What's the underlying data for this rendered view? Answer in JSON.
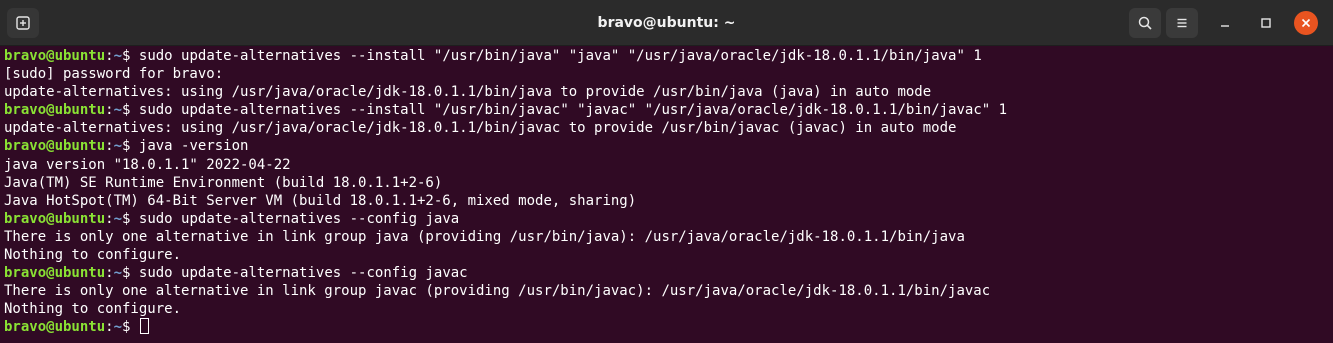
{
  "window": {
    "title": "bravo@ubuntu: ~"
  },
  "terminal": {
    "prompt": {
      "user_host": "bravo@ubuntu",
      "colon": ":",
      "path": "~",
      "symbol": "$ "
    },
    "lines": [
      {
        "type": "command",
        "text": "sudo update-alternatives --install \"/usr/bin/java\" \"java\" \"/usr/java/oracle/jdk-18.0.1.1/bin/java\" 1"
      },
      {
        "type": "output",
        "text": "[sudo] password for bravo:"
      },
      {
        "type": "output",
        "text": "update-alternatives: using /usr/java/oracle/jdk-18.0.1.1/bin/java to provide /usr/bin/java (java) in auto mode"
      },
      {
        "type": "command",
        "text": "sudo update-alternatives --install \"/usr/bin/javac\" \"javac\" \"/usr/java/oracle/jdk-18.0.1.1/bin/javac\" 1"
      },
      {
        "type": "output",
        "text": "update-alternatives: using /usr/java/oracle/jdk-18.0.1.1/bin/javac to provide /usr/bin/javac (javac) in auto mode"
      },
      {
        "type": "command",
        "text": "java -version"
      },
      {
        "type": "output",
        "text": "java version \"18.0.1.1\" 2022-04-22"
      },
      {
        "type": "output",
        "text": "Java(TM) SE Runtime Environment (build 18.0.1.1+2-6)"
      },
      {
        "type": "output",
        "text": "Java HotSpot(TM) 64-Bit Server VM (build 18.0.1.1+2-6, mixed mode, sharing)"
      },
      {
        "type": "command",
        "text": "sudo update-alternatives --config java"
      },
      {
        "type": "output",
        "text": "There is only one alternative in link group java (providing /usr/bin/java): /usr/java/oracle/jdk-18.0.1.1/bin/java"
      },
      {
        "type": "output",
        "text": "Nothing to configure."
      },
      {
        "type": "command",
        "text": "sudo update-alternatives --config javac"
      },
      {
        "type": "output",
        "text": "There is only one alternative in link group javac (providing /usr/bin/javac): /usr/java/oracle/jdk-18.0.1.1/bin/javac"
      },
      {
        "type": "output",
        "text": "Nothing to configure."
      },
      {
        "type": "current",
        "text": ""
      }
    ]
  },
  "colors": {
    "background": "#300a24",
    "prompt_user": "#8ae234",
    "prompt_path": "#729fcf",
    "text": "#ffffff",
    "titlebar": "#2b2b2b",
    "close_button": "#e95420"
  },
  "icons": {
    "new_tab": "new-tab-icon",
    "search": "search-icon",
    "menu": "hamburger-menu-icon",
    "minimize": "minimize-icon",
    "maximize": "maximize-icon",
    "close": "close-icon"
  }
}
